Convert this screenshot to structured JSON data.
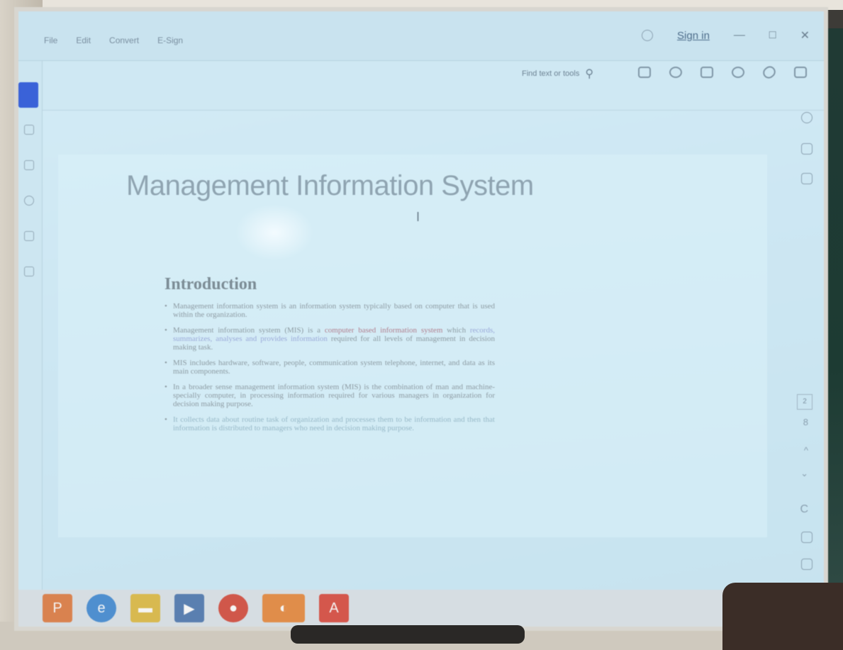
{
  "window": {
    "menu": [
      "File",
      "Edit",
      "Convert",
      "E-Sign"
    ],
    "sign_in": "Sign in",
    "minimize": "—",
    "maximize": "□",
    "close": "✕"
  },
  "toolbar": {
    "find_label": "Find text or tools",
    "icons": [
      "save-icon",
      "cloud-upload-icon",
      "print-icon",
      "search-zoom-icon",
      "link-icon",
      "sidebar-icon"
    ]
  },
  "right_rail": {
    "page_number": "2",
    "page_total": "8",
    "up": "^",
    "down": "⌄",
    "refresh": "C"
  },
  "slide": {
    "title": "Management Information System",
    "heading": "Introduction",
    "bullets": [
      {
        "text": "Management information system is an information system typically based on computer that is used within the organization."
      },
      {
        "pre": "Management information system (MIS) is a ",
        "hl1": "computer based information system",
        "mid": " which ",
        "hl2": "records, summarizes, analyses and provides information",
        "post": " required for all levels of management in decision making task."
      },
      {
        "text": "MIS includes hardware, software, people, communication system telephone, internet, and data as its main components."
      },
      {
        "text": "In a broader sense management information system (MIS) is the combination of man and machine- specially computer, in processing information required for various managers in organization for decision making purpose."
      },
      {
        "text": "It collects data about routine task of organization and processes them to be information and then that information is distributed to managers who need in decision making purpose.",
        "faded": true
      }
    ]
  },
  "taskbar": {
    "apps": [
      {
        "name": "powerpoint-icon",
        "glyph": "P",
        "color": "#d9824f"
      },
      {
        "name": "internet-explorer-icon",
        "glyph": "e",
        "color": "#4f8fcf"
      },
      {
        "name": "file-explorer-icon",
        "glyph": "▬",
        "color": "#d8b950"
      },
      {
        "name": "media-player-icon",
        "glyph": "▶",
        "color": "#5a7fb0"
      },
      {
        "name": "chrome-icon",
        "glyph": "●",
        "color": "#d0574a"
      },
      {
        "name": "firefox-icon",
        "glyph": "◐",
        "color": "#e08d4a"
      },
      {
        "name": "acrobat-icon",
        "glyph": "A",
        "color": "#d4574c"
      }
    ]
  },
  "colors": {
    "accent": "#3a62d8",
    "screen_bg": "#cde7f3"
  }
}
